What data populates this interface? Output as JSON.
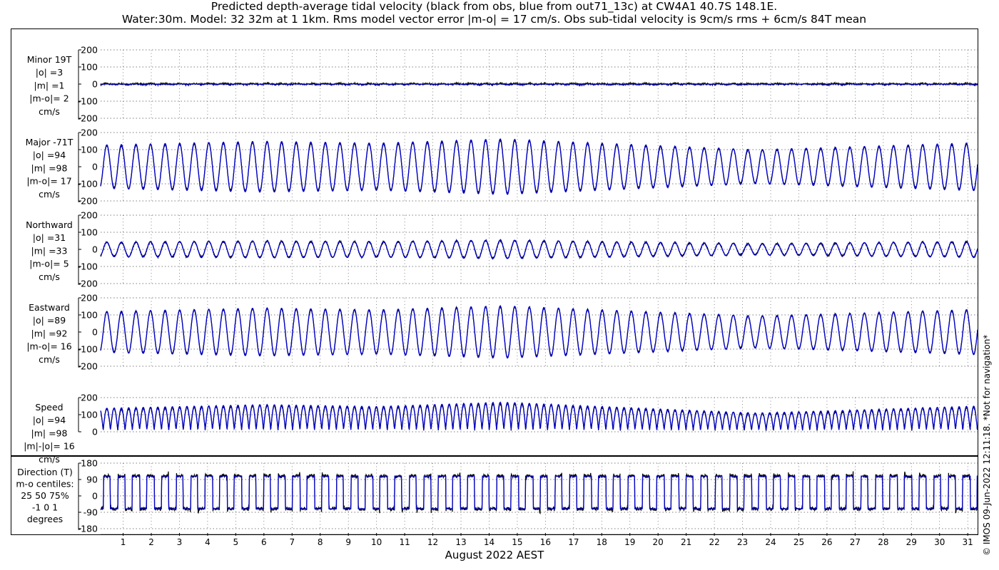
{
  "title_line1": "Predicted depth-average tidal velocity (black from obs, blue from out71_13c) at CW4A1 40.7S 148.1E.",
  "title_line2": "Water:30m. Model: 32 32m at 1 1km. Rms model vector error |m-o| = 17 cm/s. Obs sub-tidal velocity is 9cm/s rms + 6cm/s 84T mean",
  "copyright": "© IMOS 09-Jun-2022 12:11:18. *Not for navigation*",
  "colors": {
    "obs": "#000000",
    "model": "#0000cc",
    "grid": "#555555"
  },
  "chart_data": {
    "type": "line",
    "xlabel": "August 2022 AEST",
    "x_tick_labels": [
      "1",
      "2",
      "3",
      "4",
      "5",
      "6",
      "7",
      "8",
      "9",
      "10",
      "11",
      "12",
      "13",
      "14",
      "15",
      "16",
      "17",
      "18",
      "19",
      "20",
      "21",
      "22",
      "23",
      "24",
      "25",
      "26",
      "27",
      "28",
      "29",
      "30",
      "31"
    ],
    "xlim": [
      0.2,
      31.35
    ],
    "series_legend": {
      "obs": "black from obs",
      "model": "blue from out71_13c"
    },
    "panels": [
      {
        "id": "minor",
        "label_lines": [
          "Minor 19T",
          "|o| =3",
          "|m| =1",
          "|m-o|= 2",
          "cm/s"
        ],
        "ylim": [
          -200,
          200
        ],
        "yticks": [
          -200,
          -100,
          0,
          100,
          200
        ],
        "amplitude_obs": 3,
        "amplitude_model": 1,
        "stat_o": 3,
        "stat_m": 1,
        "stat_err": 2
      },
      {
        "id": "major",
        "label_lines": [
          "Major -71T",
          "|o| =94",
          "|m| =98",
          "|m-o|= 17",
          "cm/s"
        ],
        "ylim": [
          -200,
          200
        ],
        "yticks": [
          -200,
          -100,
          0,
          100,
          200
        ],
        "amplitude_obs": 132,
        "amplitude_model": 138,
        "stat_o": 94,
        "stat_m": 98,
        "stat_err": 17
      },
      {
        "id": "northward",
        "label_lines": [
          "Northward",
          "|o| =31",
          "|m| =33",
          "|m-o|= 5",
          "cm/s"
        ],
        "ylim": [
          -200,
          200
        ],
        "yticks": [
          -200,
          -100,
          0,
          100,
          200
        ],
        "amplitude_obs": 44,
        "amplitude_model": 46,
        "stat_o": 31,
        "stat_m": 33,
        "stat_err": 5
      },
      {
        "id": "eastward",
        "label_lines": [
          "Eastward",
          "|o| =89",
          "|m| =92",
          "|m-o|= 16",
          "cm/s"
        ],
        "ylim": [
          -200,
          200
        ],
        "yticks": [
          -200,
          -100,
          0,
          100,
          200
        ],
        "amplitude_obs": 126,
        "amplitude_model": 130,
        "stat_o": 89,
        "stat_m": 92,
        "stat_err": 16
      },
      {
        "id": "speed",
        "label_lines": [
          "Speed",
          "|o| =94",
          "|m| =98",
          "|m|-|o|= 16",
          "cm/s"
        ],
        "ylim": [
          0,
          200
        ],
        "yticks": [
          0,
          100,
          200
        ],
        "amplitude_obs": 132,
        "amplitude_model": 138,
        "stat_o": 94,
        "stat_m": 98,
        "stat_err": 16
      },
      {
        "id": "direction",
        "label_lines": [
          "Direction (T)",
          "m-o centiles:",
          "25  50  75%",
          "-1  0  1",
          "degrees"
        ],
        "ylim": [
          -180,
          180
        ],
        "yticks": [
          -180,
          -90,
          0,
          90,
          180
        ],
        "directions_deg": [
          109,
          -71
        ],
        "centiles": {
          "p25": -1,
          "p50": 0,
          "p75": 1
        }
      }
    ],
    "tidal_period_hours": 12.42,
    "spring_neap_days": [
      {
        "day": 0.2,
        "factor": 0.92
      },
      {
        "day": 6,
        "factor": 1.08
      },
      {
        "day": 10,
        "factor": 1.0
      },
      {
        "day": 14.5,
        "factor": 1.18
      },
      {
        "day": 18,
        "factor": 1.0
      },
      {
        "day": 23.5,
        "factor": 0.72
      },
      {
        "day": 27,
        "factor": 0.85
      },
      {
        "day": 31.35,
        "factor": 1.02
      }
    ]
  }
}
